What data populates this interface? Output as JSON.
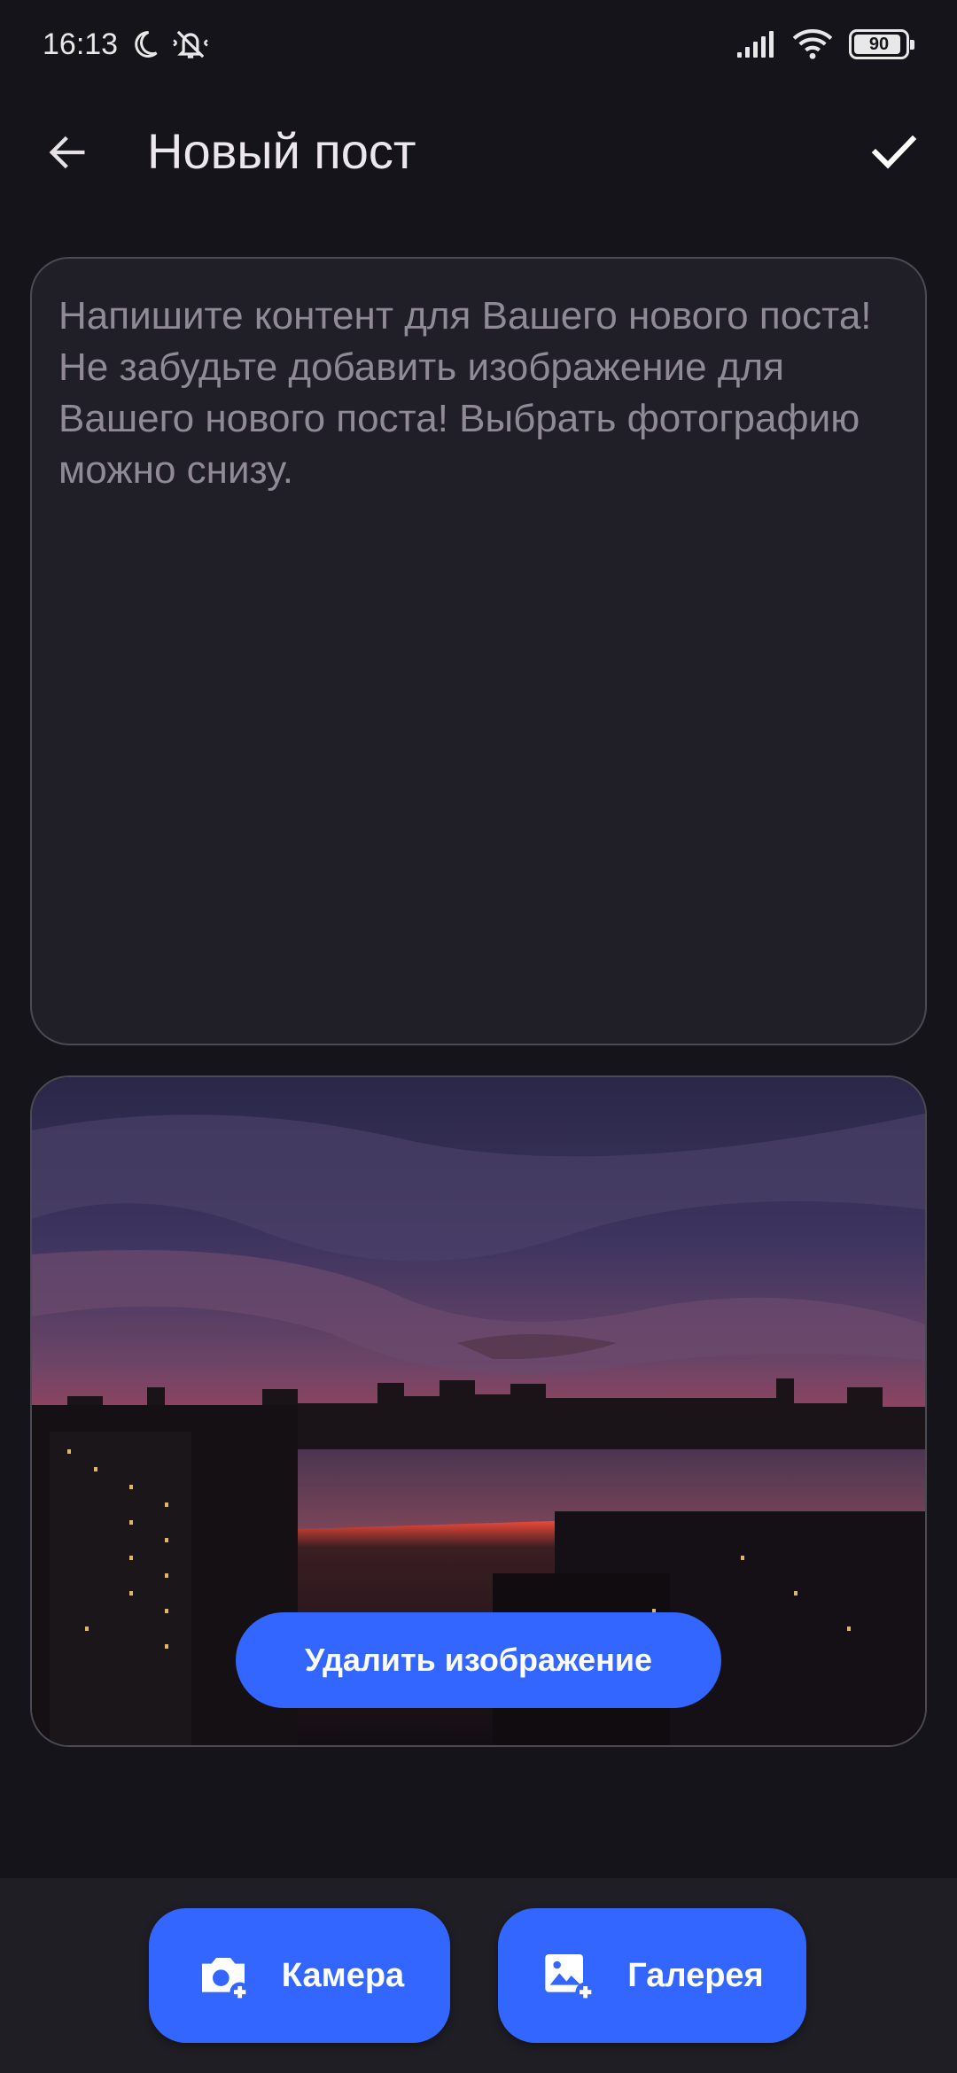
{
  "status_bar": {
    "time": "16:13",
    "battery": "90",
    "icons": [
      "moon-icon",
      "bell-off-icon",
      "signal-icon",
      "wifi-icon",
      "battery-icon"
    ]
  },
  "app_bar": {
    "title": "Новый пост",
    "back_icon": "arrow-back-icon",
    "confirm_icon": "check-icon"
  },
  "editor": {
    "placeholder": "Напишите контент для Вашего нового поста! Не забудьте добавить изображение для Вашего нового поста! Выбрать фотографию можно снизу."
  },
  "image_preview": {
    "delete_label": "Удалить изображение"
  },
  "bottom_bar": {
    "camera_label": "Камера",
    "gallery_label": "Галерея",
    "camera_icon": "camera-add-icon",
    "gallery_icon": "image-add-icon"
  },
  "colors": {
    "accent": "#3366ff",
    "background": "#15141a",
    "surface": "#201e26"
  }
}
